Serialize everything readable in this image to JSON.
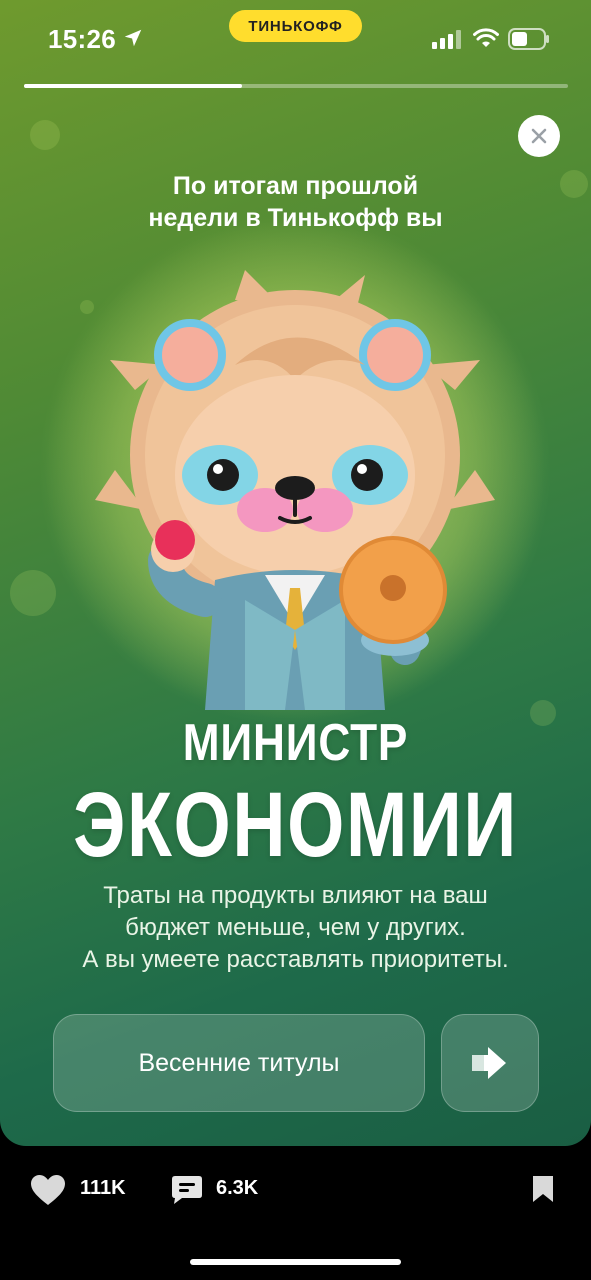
{
  "status": {
    "time": "15:26",
    "brand": "ТИНЬКОФФ",
    "icons": [
      "location-arrow-icon",
      "signal-icon",
      "wifi-icon",
      "battery-icon"
    ]
  },
  "story": {
    "progress": 0.4,
    "subtitle_line1": "По итогам прошлой",
    "subtitle_line2": "недели в Тинькофф вы",
    "title_line1": "МИНИСТР",
    "title_line2": "ЭКОНОМИИ",
    "desc_line1": "Траты на продукты влияют на ваш",
    "desc_line2": "бюджет меньше, чем у других.",
    "desc_line3": "А вы умеете расставлять приоритеты.",
    "button_label": "Весенние титулы",
    "colors": {
      "brand_yellow": "#ffdd2d",
      "bg_green": "#2f7a45"
    }
  },
  "footer": {
    "likes": "111K",
    "comments": "6.3K"
  }
}
